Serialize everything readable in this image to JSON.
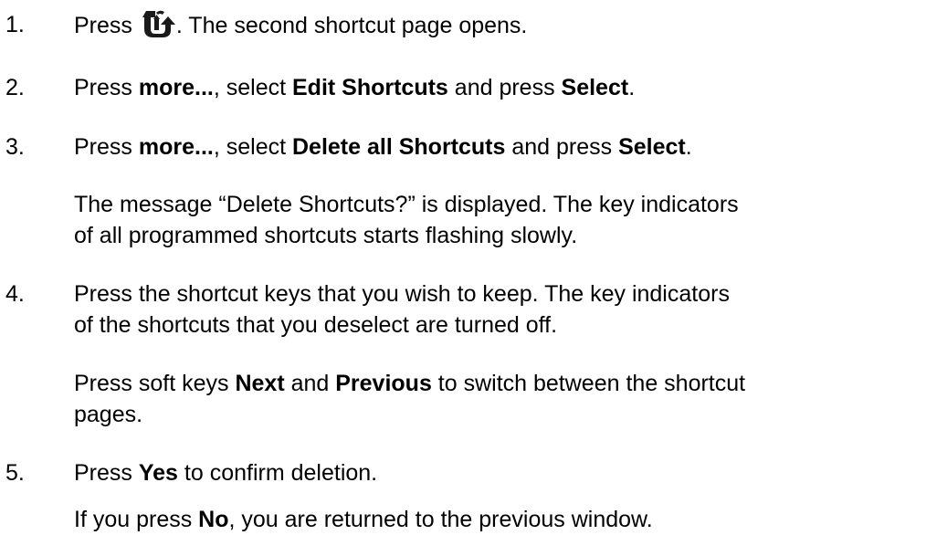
{
  "steps": [
    {
      "number": "1.",
      "before_icon": "Press ",
      "icon": "shortcut-key-icon",
      "after_icon": ". The second shortcut page opens."
    },
    {
      "number": "2.",
      "t1": "Press ",
      "b1": "more...",
      "t2": ", select ",
      "b2": "Edit Shortcuts",
      "t3": " and press ",
      "b3": "Select",
      "t4": "."
    },
    {
      "number": "3.",
      "t1": "Press ",
      "b1": "more...",
      "t2": ", select ",
      "b2": "Delete all Shortcuts",
      "t3": " and press ",
      "b3": "Select",
      "t4": ".",
      "note_line1": "The message “Delete Shortcuts?” is displayed. The key indicators",
      "note_line2": "of all programmed shortcuts starts flashing slowly."
    },
    {
      "number": "4.",
      "line1": "Press the shortcut keys that you wish to keep. The key indicators",
      "line2": "of the shortcuts that you deselect are turned off.",
      "note_t1": "Press soft keys ",
      "note_b1": "Next",
      "note_t2": " and ",
      "note_b2": "Previous",
      "note_t3": " to switch between the shortcut",
      "note_line2": "pages."
    },
    {
      "number": "5.",
      "t1": "Press ",
      "b1": "Yes",
      "t2": " to confirm deletion.",
      "note_t1": "If you press ",
      "note_b1": "No",
      "note_t2": ", you are returned to the previous window."
    }
  ]
}
